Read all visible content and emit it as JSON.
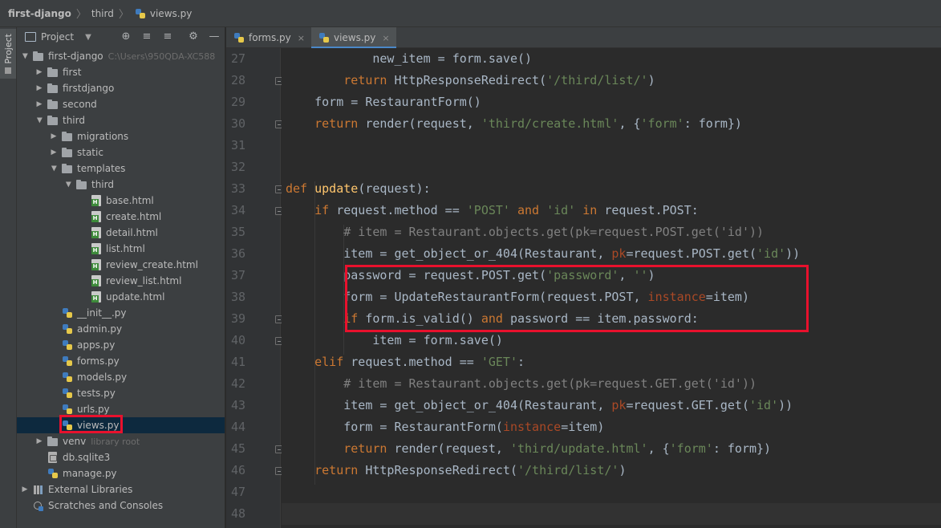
{
  "breadcrumb": [
    "first-django",
    "third",
    "views.py"
  ],
  "tool_stripe": {
    "project_label": "Project"
  },
  "project_panel": {
    "title": "Project",
    "toolbar_icons": [
      "locate-icon",
      "expand-all-icon",
      "collapse-all-icon",
      "gear-icon",
      "minimize-icon"
    ],
    "tree": [
      {
        "label": "first-django",
        "hint": "C:\\Users\\950QDA-XC588",
        "depth": 0,
        "icon": "folder",
        "arrow": "open"
      },
      {
        "label": "first",
        "depth": 1,
        "icon": "folder",
        "arrow": "closed"
      },
      {
        "label": "firstdjango",
        "depth": 1,
        "icon": "folder",
        "arrow": "closed"
      },
      {
        "label": "second",
        "depth": 1,
        "icon": "folder",
        "arrow": "closed"
      },
      {
        "label": "third",
        "depth": 1,
        "icon": "folder",
        "arrow": "open"
      },
      {
        "label": "migrations",
        "depth": 2,
        "icon": "folder",
        "arrow": "closed"
      },
      {
        "label": "static",
        "depth": 2,
        "icon": "folder",
        "arrow": "closed"
      },
      {
        "label": "templates",
        "depth": 2,
        "icon": "folder",
        "arrow": "open"
      },
      {
        "label": "third",
        "depth": 3,
        "icon": "folder",
        "arrow": "open"
      },
      {
        "label": "base.html",
        "depth": 4,
        "icon": "html",
        "arrow": "none"
      },
      {
        "label": "create.html",
        "depth": 4,
        "icon": "html",
        "arrow": "none"
      },
      {
        "label": "detail.html",
        "depth": 4,
        "icon": "html",
        "arrow": "none"
      },
      {
        "label": "list.html",
        "depth": 4,
        "icon": "html",
        "arrow": "none"
      },
      {
        "label": "review_create.html",
        "depth": 4,
        "icon": "html",
        "arrow": "none"
      },
      {
        "label": "review_list.html",
        "depth": 4,
        "icon": "html",
        "arrow": "none"
      },
      {
        "label": "update.html",
        "depth": 4,
        "icon": "html",
        "arrow": "none"
      },
      {
        "label": "__init__.py",
        "depth": 2,
        "icon": "py",
        "arrow": "none"
      },
      {
        "label": "admin.py",
        "depth": 2,
        "icon": "py",
        "arrow": "none"
      },
      {
        "label": "apps.py",
        "depth": 2,
        "icon": "py",
        "arrow": "none"
      },
      {
        "label": "forms.py",
        "depth": 2,
        "icon": "py",
        "arrow": "none"
      },
      {
        "label": "models.py",
        "depth": 2,
        "icon": "py",
        "arrow": "none"
      },
      {
        "label": "tests.py",
        "depth": 2,
        "icon": "py",
        "arrow": "none"
      },
      {
        "label": "urls.py",
        "depth": 2,
        "icon": "py",
        "arrow": "none"
      },
      {
        "label": "views.py",
        "depth": 2,
        "icon": "py",
        "arrow": "none",
        "selected": true
      },
      {
        "label": "venv",
        "hint": "library root",
        "depth": 1,
        "icon": "folder",
        "arrow": "closed"
      },
      {
        "label": "db.sqlite3",
        "depth": 1,
        "icon": "db",
        "arrow": "none"
      },
      {
        "label": "manage.py",
        "depth": 1,
        "icon": "py",
        "arrow": "none"
      },
      {
        "label": "External Libraries",
        "depth": 0,
        "icon": "lib",
        "arrow": "closed"
      },
      {
        "label": "Scratches and Consoles",
        "depth": 0,
        "icon": "scratch",
        "arrow": "none"
      }
    ]
  },
  "editor": {
    "tabs": [
      {
        "label": "forms.py",
        "close": "×",
        "active": false
      },
      {
        "label": "views.py",
        "close": "×",
        "active": true
      }
    ],
    "lines": [
      {
        "n": "27",
        "fold": false,
        "segs": [
          [
            "p",
            "            new_item = form.save()"
          ]
        ]
      },
      {
        "n": "28",
        "fold": true,
        "segs": [
          [
            "k",
            "        return "
          ],
          [
            "p",
            "HttpResponseRedirect("
          ],
          [
            "s",
            "'/third/list/'"
          ],
          [
            "p",
            ")"
          ]
        ]
      },
      {
        "n": "29",
        "fold": false,
        "segs": [
          [
            "p",
            "    form = RestaurantForm()"
          ]
        ]
      },
      {
        "n": "30",
        "fold": true,
        "segs": [
          [
            "k",
            "    return "
          ],
          [
            "p",
            "render(request, "
          ],
          [
            "s",
            "'third/create.html'"
          ],
          [
            "p",
            ", {"
          ],
          [
            "s",
            "'form'"
          ],
          [
            "p",
            ": form})"
          ]
        ]
      },
      {
        "n": "31",
        "fold": false,
        "segs": []
      },
      {
        "n": "32",
        "fold": false,
        "segs": []
      },
      {
        "n": "33",
        "fold": true,
        "segs": [
          [
            "k",
            "def "
          ],
          [
            "f",
            "update"
          ],
          [
            "p",
            "(request):"
          ]
        ]
      },
      {
        "n": "34",
        "fold": true,
        "segs": [
          [
            "k",
            "    if "
          ],
          [
            "p",
            "request.method == "
          ],
          [
            "s",
            "'POST' "
          ],
          [
            "k",
            "and "
          ],
          [
            "s",
            "'id' "
          ],
          [
            "k",
            "in "
          ],
          [
            "p",
            "request.POST:"
          ]
        ]
      },
      {
        "n": "35",
        "fold": false,
        "segs": [
          [
            "c",
            "        # item = Restaurant.objects.get(pk=request.POST.get('id'))"
          ]
        ]
      },
      {
        "n": "36",
        "fold": false,
        "segs": [
          [
            "p",
            "        item = get_object_or_404(Restaurant, "
          ],
          [
            "a",
            "pk"
          ],
          [
            "p",
            "=request.POST.get("
          ],
          [
            "s",
            "'id'"
          ],
          [
            "p",
            "))"
          ]
        ]
      },
      {
        "n": "37",
        "fold": false,
        "segs": [
          [
            "p",
            "        password = request.POST.get("
          ],
          [
            "s",
            "'password'"
          ],
          [
            "p",
            ", "
          ],
          [
            "s",
            "''"
          ],
          [
            "p",
            ")"
          ]
        ]
      },
      {
        "n": "38",
        "fold": false,
        "segs": [
          [
            "p",
            "        form = UpdateRestaurantForm(request.POST, "
          ],
          [
            "a",
            "instance"
          ],
          [
            "p",
            "=item)"
          ]
        ]
      },
      {
        "n": "39",
        "fold": true,
        "segs": [
          [
            "k",
            "        if "
          ],
          [
            "p",
            "form.is_valid() "
          ],
          [
            "k",
            "and "
          ],
          [
            "p",
            "password == item.password:"
          ]
        ]
      },
      {
        "n": "40",
        "fold": true,
        "segs": [
          [
            "p",
            "            item = form.save()"
          ]
        ]
      },
      {
        "n": "41",
        "fold": false,
        "segs": [
          [
            "k",
            "    elif "
          ],
          [
            "p",
            "request.method == "
          ],
          [
            "s",
            "'GET'"
          ],
          [
            "p",
            ":"
          ]
        ]
      },
      {
        "n": "42",
        "fold": false,
        "segs": [
          [
            "c",
            "        # item = Restaurant.objects.get(pk=request.GET.get('id'))"
          ]
        ]
      },
      {
        "n": "43",
        "fold": false,
        "segs": [
          [
            "p",
            "        item = get_object_or_404(Restaurant, "
          ],
          [
            "a",
            "pk"
          ],
          [
            "p",
            "=request.GET.get("
          ],
          [
            "s",
            "'id'"
          ],
          [
            "p",
            "))"
          ]
        ]
      },
      {
        "n": "44",
        "fold": false,
        "segs": [
          [
            "p",
            "        form = RestaurantForm("
          ],
          [
            "a",
            "instance"
          ],
          [
            "p",
            "=item)"
          ]
        ]
      },
      {
        "n": "45",
        "fold": true,
        "segs": [
          [
            "k",
            "        return "
          ],
          [
            "p",
            "render(request, "
          ],
          [
            "s",
            "'third/update.html'"
          ],
          [
            "p",
            ", {"
          ],
          [
            "s",
            "'form'"
          ],
          [
            "p",
            ": form})"
          ]
        ]
      },
      {
        "n": "46",
        "fold": true,
        "segs": [
          [
            "k",
            "    return "
          ],
          [
            "p",
            "HttpResponseRedirect("
          ],
          [
            "s",
            "'/third/list/'"
          ],
          [
            "p",
            ")"
          ]
        ]
      },
      {
        "n": "47",
        "fold": false,
        "segs": []
      },
      {
        "n": "48",
        "fold": false,
        "segs": []
      }
    ]
  },
  "colors": {
    "keyword": "#cc7832",
    "function": "#ffc66d",
    "string": "#6a8759",
    "comment": "#808080",
    "kwarg": "#aa4926",
    "text": "#a9b7c6",
    "highlight_box": "#e8112d"
  }
}
